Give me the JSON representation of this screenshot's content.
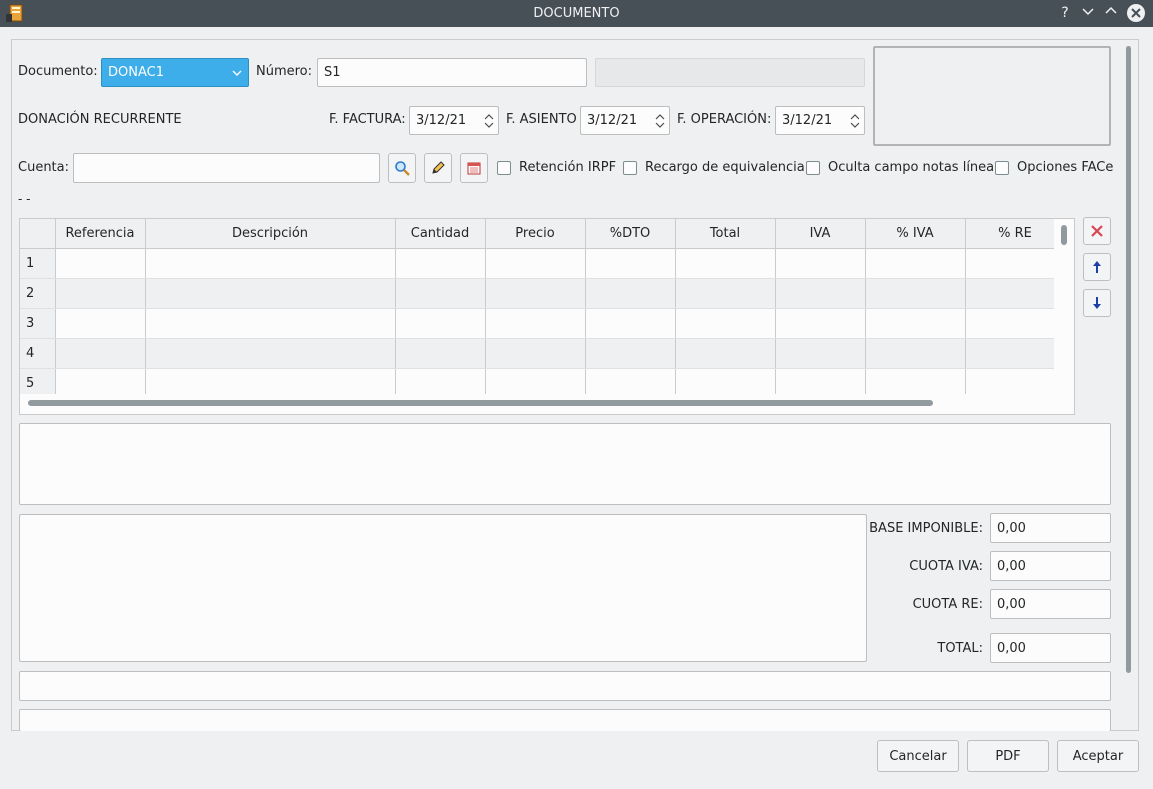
{
  "window": {
    "title": "DOCUMENTO",
    "help": "?",
    "minimize": "⌄",
    "maximize": "⌃",
    "close": "✕"
  },
  "header": {
    "documento_label": "Documento:",
    "documento_value": "DONAC1",
    "numero_label": "Número:",
    "numero_value": "S1",
    "doc_description": "DONACIÓN RECURRENTE",
    "f_factura_label": "F. FACTURA:",
    "f_factura_value": "3/12/21",
    "f_asiento_label": "F. ASIENTO",
    "f_asiento_value": "3/12/21",
    "f_operacion_label": "F. OPERACIÓN:",
    "f_operacion_value": "3/12/21",
    "cuenta_label": "Cuenta:",
    "cuenta_value": "",
    "cuenta_info": "- -"
  },
  "options": {
    "retencion_irpf": "Retención IRPF",
    "recargo_equivalencia": "Recargo de equivalencia",
    "oculta_notas": "Oculta campo notas línea",
    "opciones_face": "Opciones FACe"
  },
  "table": {
    "columns": [
      "Referencia",
      "Descripción",
      "Cantidad",
      "Precio",
      "%DTO",
      "Total",
      "IVA",
      "% IVA",
      "% RE"
    ],
    "rows": [
      "1",
      "2",
      "3",
      "4",
      "5"
    ]
  },
  "totals": {
    "base_imponible_label": "BASE IMPONIBLE:",
    "base_imponible_value": "0,00",
    "cuota_iva_label": "CUOTA IVA:",
    "cuota_iva_value": "0,00",
    "cuota_re_label": "CUOTA RE:",
    "cuota_re_value": "0,00",
    "total_label": "TOTAL:",
    "total_value": "0,00"
  },
  "buttons": {
    "cancelar": "Cancelar",
    "pdf": "PDF",
    "aceptar": "Aceptar"
  },
  "colors": {
    "accent": "#3daee9",
    "titlebar": "#475057",
    "delete_red": "#da4453",
    "arrow_blue": "#1d3fa8"
  }
}
